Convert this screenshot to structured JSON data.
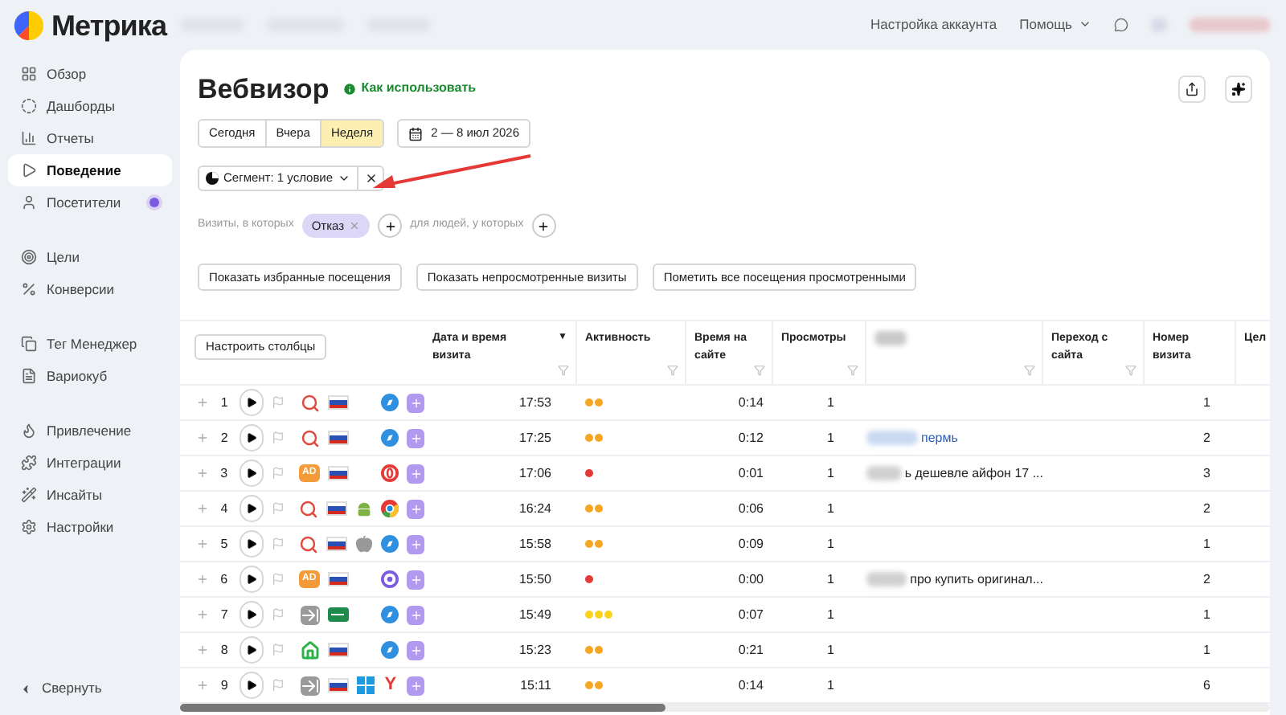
{
  "logo": "Метрика",
  "top_links": [
    {
      "label": "Настройка аккаунта",
      "kind": "link"
    },
    {
      "label": "Помощь",
      "kind": "menu"
    }
  ],
  "sidebar": {
    "groups": [
      [
        {
          "label": "Обзор",
          "selected": false,
          "badge": false
        },
        {
          "label": "Дашборды",
          "selected": false,
          "badge": false
        },
        {
          "label": "Отчеты",
          "selected": false,
          "badge": false
        },
        {
          "label": "Поведение",
          "selected": true,
          "badge": false
        },
        {
          "label": "Посетители",
          "selected": false,
          "badge": true
        }
      ],
      [
        {
          "label": "Цели",
          "selected": false,
          "badge": false
        },
        {
          "label": "Конверсии",
          "selected": false,
          "badge": false
        }
      ],
      [
        {
          "label": "Тег Менеджер",
          "selected": false,
          "badge": false
        },
        {
          "label": "Вариокуб",
          "selected": false,
          "badge": false
        }
      ],
      [
        {
          "label": "Привлечение",
          "selected": false,
          "badge": false
        },
        {
          "label": "Интеграции",
          "selected": false,
          "badge": false
        },
        {
          "label": "Инсайты",
          "selected": false,
          "badge": false
        },
        {
          "label": "Настройки",
          "selected": false,
          "badge": false
        }
      ]
    ],
    "collapse": "Свернуть"
  },
  "page": {
    "title": "Вебвизор",
    "help_link": "Как использовать",
    "periods": [
      {
        "label": "Сегодня",
        "selected": false
      },
      {
        "label": "Вчера",
        "selected": false
      },
      {
        "label": "Неделя",
        "selected": true
      }
    ],
    "date_range": "2 — 8 июл 2026",
    "segment": "Сегмент: 1 условие",
    "filter": {
      "visits_label": "Визиты, в которых",
      "chip": "Отказ",
      "people_label": "для людей, у которых"
    },
    "actions": [
      "Показать избранные посещения",
      "Показать непросмотренные визиты",
      "Пометить все посещения просмотренными"
    ]
  },
  "table": {
    "configure": "Настроить столбцы",
    "columns": [
      {
        "label": "Дата и время визита",
        "sort_mark": "▼"
      },
      {
        "label": "Активность"
      },
      {
        "label": "Время на сайте"
      },
      {
        "label": "Просмотры"
      },
      {
        "kind": "blurred"
      },
      {
        "label": "Переход с сайта"
      },
      {
        "label": "Номер визита"
      },
      {
        "label": "Цел"
      }
    ],
    "rows": [
      {
        "n": "1",
        "icons": [
          {
            "kind": "search"
          },
          {
            "kind": "flag"
          },
          {
            "kind": "none"
          },
          {
            "kind": "compass"
          }
        ],
        "time": "17:53",
        "activity": [
          {
            "color": "#f5a623"
          },
          {
            "color": "#f5a623"
          }
        ],
        "duration": "0:14",
        "views": "1",
        "visit": "1"
      },
      {
        "n": "2",
        "icons": [
          {
            "kind": "search"
          },
          {
            "kind": "flag"
          },
          {
            "kind": "none"
          },
          {
            "kind": "compass"
          }
        ],
        "time": "17:25",
        "activity": [
          {
            "color": "#f5a623"
          },
          {
            "color": "#f5a623"
          }
        ],
        "duration": "0:12",
        "views": "1",
        "phrase": {
          "text": "пермь",
          "link": true
        },
        "visit": "2"
      },
      {
        "n": "3",
        "icons": [
          {
            "kind": "ad",
            "label": "AD"
          },
          {
            "kind": "flag"
          },
          {
            "kind": "none"
          },
          {
            "kind": "red-ring"
          }
        ],
        "time": "17:06",
        "activity": [
          {
            "color": "#e53935"
          }
        ],
        "duration": "0:01",
        "views": "1",
        "phrase": {
          "text": "ь дешевле айфон 17 ...",
          "link": false
        },
        "visit": "3"
      },
      {
        "n": "4",
        "icons": [
          {
            "kind": "search"
          },
          {
            "kind": "flag"
          },
          {
            "kind": "android"
          },
          {
            "kind": "chrome"
          }
        ],
        "time": "16:24",
        "activity": [
          {
            "color": "#f5a623"
          },
          {
            "color": "#f5a623"
          }
        ],
        "duration": "0:06",
        "views": "1",
        "visit": "2"
      },
      {
        "n": "5",
        "icons": [
          {
            "kind": "search"
          },
          {
            "kind": "flag"
          },
          {
            "kind": "apple"
          },
          {
            "kind": "compass"
          }
        ],
        "time": "15:58",
        "activity": [
          {
            "color": "#f5a623"
          },
          {
            "color": "#f5a623"
          }
        ],
        "duration": "0:09",
        "views": "1",
        "visit": "1"
      },
      {
        "n": "6",
        "icons": [
          {
            "kind": "ad",
            "label": "AD"
          },
          {
            "kind": "flag"
          },
          {
            "kind": "none"
          },
          {
            "kind": "purple-ring"
          }
        ],
        "time": "15:50",
        "activity": [
          {
            "color": "#e53935"
          }
        ],
        "duration": "0:00",
        "views": "1",
        "phrase": {
          "text": "про купить оригинал...",
          "link": false
        },
        "visit": "2"
      },
      {
        "n": "7",
        "icons": [
          {
            "kind": "entry"
          },
          {
            "kind": "sheet"
          },
          {
            "kind": "none"
          },
          {
            "kind": "compass"
          }
        ],
        "time": "15:49",
        "activity": [
          {
            "color": "#f8d21c"
          },
          {
            "color": "#f8d21c"
          },
          {
            "color": "#f8d21c"
          }
        ],
        "duration": "0:07",
        "views": "1",
        "visit": "1"
      },
      {
        "n": "8",
        "icons": [
          {
            "kind": "house"
          },
          {
            "kind": "flag"
          },
          {
            "kind": "none"
          },
          {
            "kind": "compass"
          }
        ],
        "time": "15:23",
        "activity": [
          {
            "color": "#f5a623"
          },
          {
            "color": "#f5a623"
          }
        ],
        "duration": "0:21",
        "views": "1",
        "visit": "1"
      },
      {
        "n": "9",
        "icons": [
          {
            "kind": "entry"
          },
          {
            "kind": "flag"
          },
          {
            "kind": "windows"
          },
          {
            "kind": "letter",
            "label": "Y"
          }
        ],
        "time": "15:11",
        "activity": [
          {
            "color": "#f5a623"
          },
          {
            "color": "#f5a623"
          }
        ],
        "duration": "0:14",
        "views": "1",
        "visit": "6"
      }
    ]
  }
}
